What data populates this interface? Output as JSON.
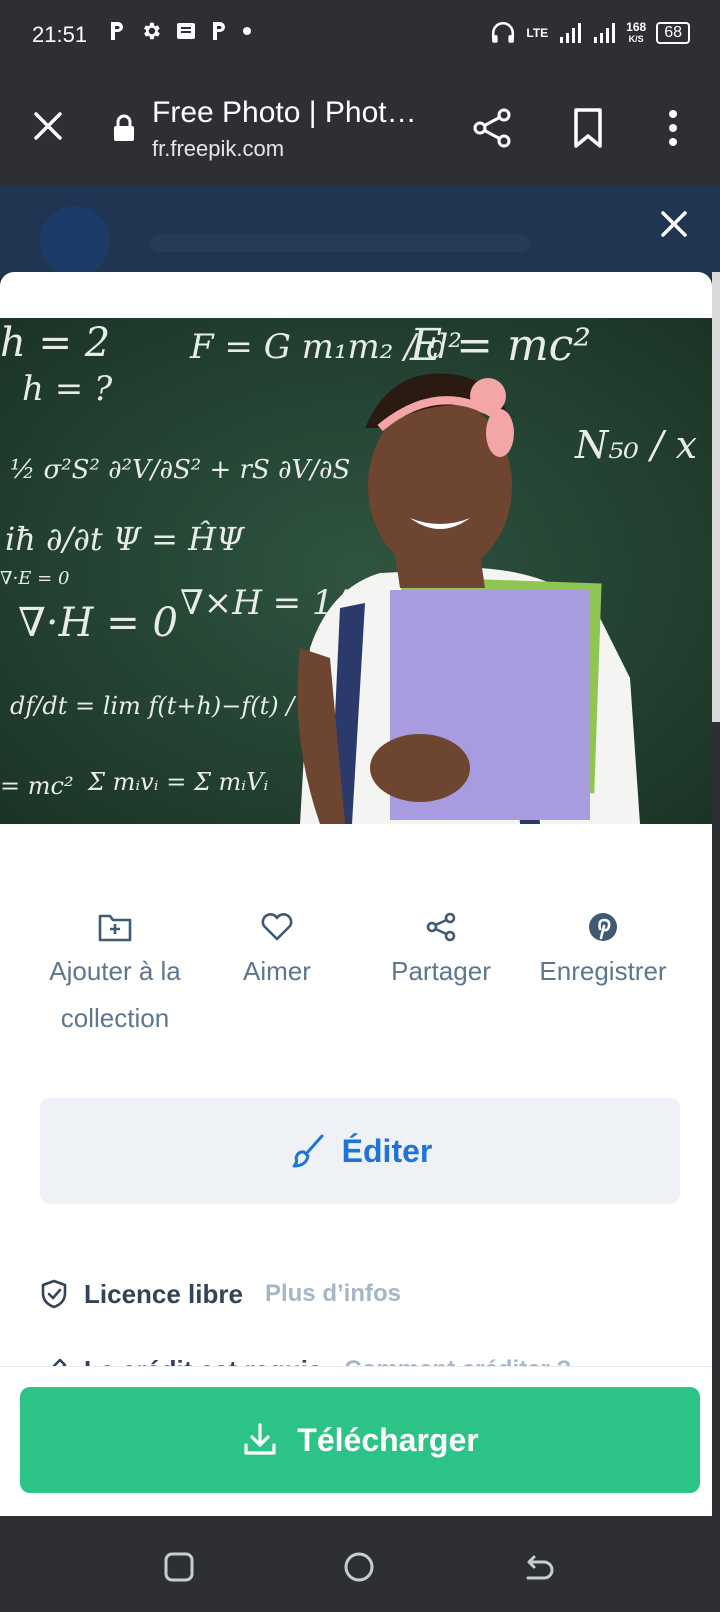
{
  "status": {
    "time": "21:51",
    "network": "LTE",
    "speed_value": "168",
    "speed_unit": "K/S",
    "battery": "68"
  },
  "toolbar": {
    "title": "Free Photo | Phot…",
    "url": "fr.freepik.com"
  },
  "actions": {
    "add_collection": "Ajouter à la collection",
    "like": "Aimer",
    "share": "Partager",
    "save": "Enregistrer"
  },
  "edit_label": "Éditer",
  "license": {
    "label": "Licence libre",
    "link": "Plus d’infos"
  },
  "credit": {
    "label": "Le crédit est requis",
    "link": "Comment créditer ?"
  },
  "download_label": "Télécharger",
  "colors": {
    "brand_green": "#2cc486",
    "link_blue": "#1f73d9",
    "muted": "#5d7791"
  },
  "photo": {
    "formulas": [
      "h = 2",
      "F = G m₁m₂ / d²",
      "E = mc²",
      "h = ?",
      "N₅₀ / x",
      "½ σ²S² ∂²V/∂S² + rS ∂V/∂S",
      "iħ ∂/∂t Ψ = ĤΨ",
      "∇·E = 0",
      "∇·H = 0",
      "∇×H = 1/c ∂E/∂t",
      "df/dt = lim f(t+h)−f(t) / h",
      "Σ mᵢvᵢ = Σ mᵢVᵢ",
      "= mc²"
    ]
  }
}
